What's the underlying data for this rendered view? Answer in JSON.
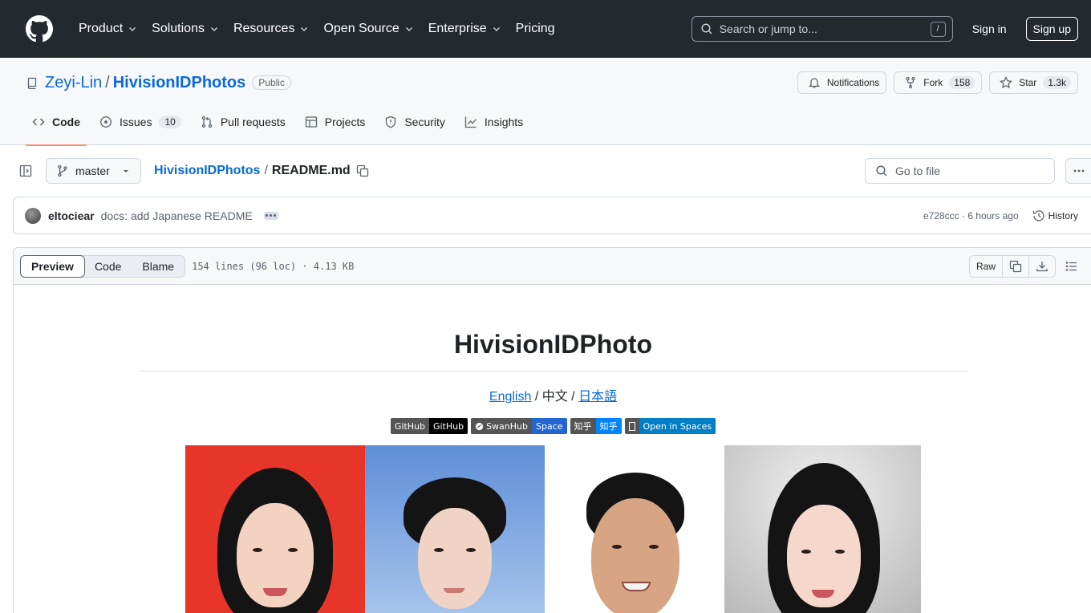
{
  "nav": {
    "items": [
      "Product",
      "Solutions",
      "Resources",
      "Open Source",
      "Enterprise",
      "Pricing"
    ],
    "search_placeholder": "Search or jump to...",
    "search_shortcut": "/",
    "signin": "Sign in",
    "signup": "Sign up"
  },
  "repo": {
    "owner": "Zeyi-Lin",
    "separator": "/",
    "name": "HivisionIDPhotos",
    "visibility": "Public",
    "notifications_label": "Notifications",
    "fork_label": "Fork",
    "fork_count": "158",
    "star_label": "Star",
    "star_count": "1.3k"
  },
  "tabs": [
    {
      "label": "Code",
      "icon": "code-icon",
      "active": true
    },
    {
      "label": "Issues",
      "icon": "issue-icon",
      "count": "10"
    },
    {
      "label": "Pull requests",
      "icon": "pull-request-icon"
    },
    {
      "label": "Projects",
      "icon": "table-icon"
    },
    {
      "label": "Security",
      "icon": "shield-icon"
    },
    {
      "label": "Insights",
      "icon": "graph-icon"
    }
  ],
  "file": {
    "branch": "master",
    "repo_crumb": "HivisionIDPhotos",
    "crumb_sep": "/",
    "filename": "README.md",
    "goto_placeholder": "Go to file"
  },
  "commit": {
    "author": "eltociear",
    "message": "docs: add Japanese README",
    "hash_time": "e728ccc · 6 hours ago",
    "history": "History"
  },
  "viewer": {
    "modes": [
      "Preview",
      "Code",
      "Blame"
    ],
    "active_mode": "Preview",
    "stats": "154 lines (96 loc) · 4.13 KB",
    "raw": "Raw"
  },
  "readme": {
    "title": "HivisionIDPhoto",
    "lang_en": "English",
    "lang_sep1": " / ",
    "lang_zh": "中文",
    "lang_sep2": " / ",
    "lang_ja": "日本語",
    "badges": [
      {
        "left": "GitHub",
        "right": "GitHub",
        "left_color": "#555555",
        "right_color": "#000000"
      },
      {
        "left": "SwanHub",
        "right": "Space",
        "left_color": "#555555",
        "right_color": "#2366d1"
      },
      {
        "left": "知乎",
        "right": "知乎",
        "left_color": "#555555",
        "right_color": "#0084ff"
      },
      {
        "left": "",
        "right": "Open in Spaces",
        "left_color": "#555555",
        "right_color": "#007ec6"
      }
    ]
  },
  "colors": {
    "header_bg": "#24292f",
    "link": "#0969da",
    "active_tab_underline": "#fd8c73"
  }
}
